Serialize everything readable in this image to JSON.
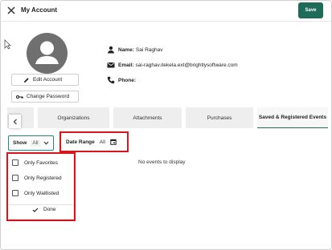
{
  "header": {
    "title": "My Account",
    "save_label": "Save",
    "close_icon": "close-icon"
  },
  "profile": {
    "avatar_icon": "avatar-placeholder-icon",
    "edit_account_label": "Edit Account",
    "change_password_label": "Change Password"
  },
  "info": {
    "name_label": "Name:",
    "name_value": "Sai Raghav",
    "email_label": "Email:",
    "email_value": "sai-raghav.itekela.ext@brightlysoftware.com",
    "phone_label": "Phone:",
    "phone_value": ""
  },
  "tabs": [
    {
      "label": "Organizations",
      "active": false
    },
    {
      "label": "Attachments",
      "active": false
    },
    {
      "label": "Purchases",
      "active": false
    },
    {
      "label": "Saved & Registered Events",
      "active": true
    }
  ],
  "tab_scroll_icon": "chevron-left-icon",
  "filters": {
    "show_label": "Show",
    "show_value": "All",
    "date_range_label": "Date Range",
    "date_range_value": "All"
  },
  "empty_message": "No events to display",
  "dropdown": {
    "options": [
      {
        "label": "Only Favorites",
        "checked": false
      },
      {
        "label": "Only Registered",
        "checked": false
      },
      {
        "label": "Only Waitlisted",
        "checked": false
      }
    ],
    "done_label": "Done"
  },
  "colors": {
    "accent": "#1e6b59",
    "highlight": "#d9161c"
  }
}
